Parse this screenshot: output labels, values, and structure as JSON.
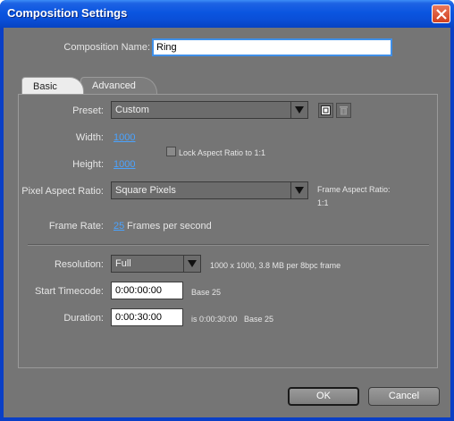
{
  "window": {
    "title": "Composition Settings"
  },
  "composition_name": {
    "label": "Composition Name:",
    "value": "Ring"
  },
  "tabs": [
    {
      "label": "Basic",
      "active": true
    },
    {
      "label": "Advanced",
      "active": false
    }
  ],
  "basic": {
    "preset": {
      "label": "Preset:",
      "value": "Custom"
    },
    "width": {
      "label": "Width:",
      "value": "1000"
    },
    "height": {
      "label": "Height:",
      "value": "1000"
    },
    "lock_aspect": {
      "label": "Lock Aspect Ratio to 1:1",
      "checked": false
    },
    "pixel_aspect": {
      "label": "Pixel Aspect Ratio:",
      "value": "Square Pixels"
    },
    "frame_aspect": {
      "label": "Frame Aspect Ratio:",
      "value": "1:1"
    },
    "frame_rate": {
      "label": "Frame Rate:",
      "value": "25",
      "unit": "Frames per second"
    },
    "resolution": {
      "label": "Resolution:",
      "value": "Full",
      "info": "1000 x 1000, 3.8 MB per 8bpc frame"
    },
    "start_timecode": {
      "label": "Start Timecode:",
      "value": "0:00:00:00",
      "base": "Base 25"
    },
    "duration": {
      "label": "Duration:",
      "value": "0:00:30:00",
      "is_text": "is 0:00:30:00",
      "base": "Base 25"
    }
  },
  "buttons": {
    "ok": "OK",
    "cancel": "Cancel"
  },
  "icons": {
    "close": "close-icon",
    "save_preset": "save-preset-icon",
    "delete_preset": "trash-icon",
    "dropdown": "chevron-down-icon"
  }
}
